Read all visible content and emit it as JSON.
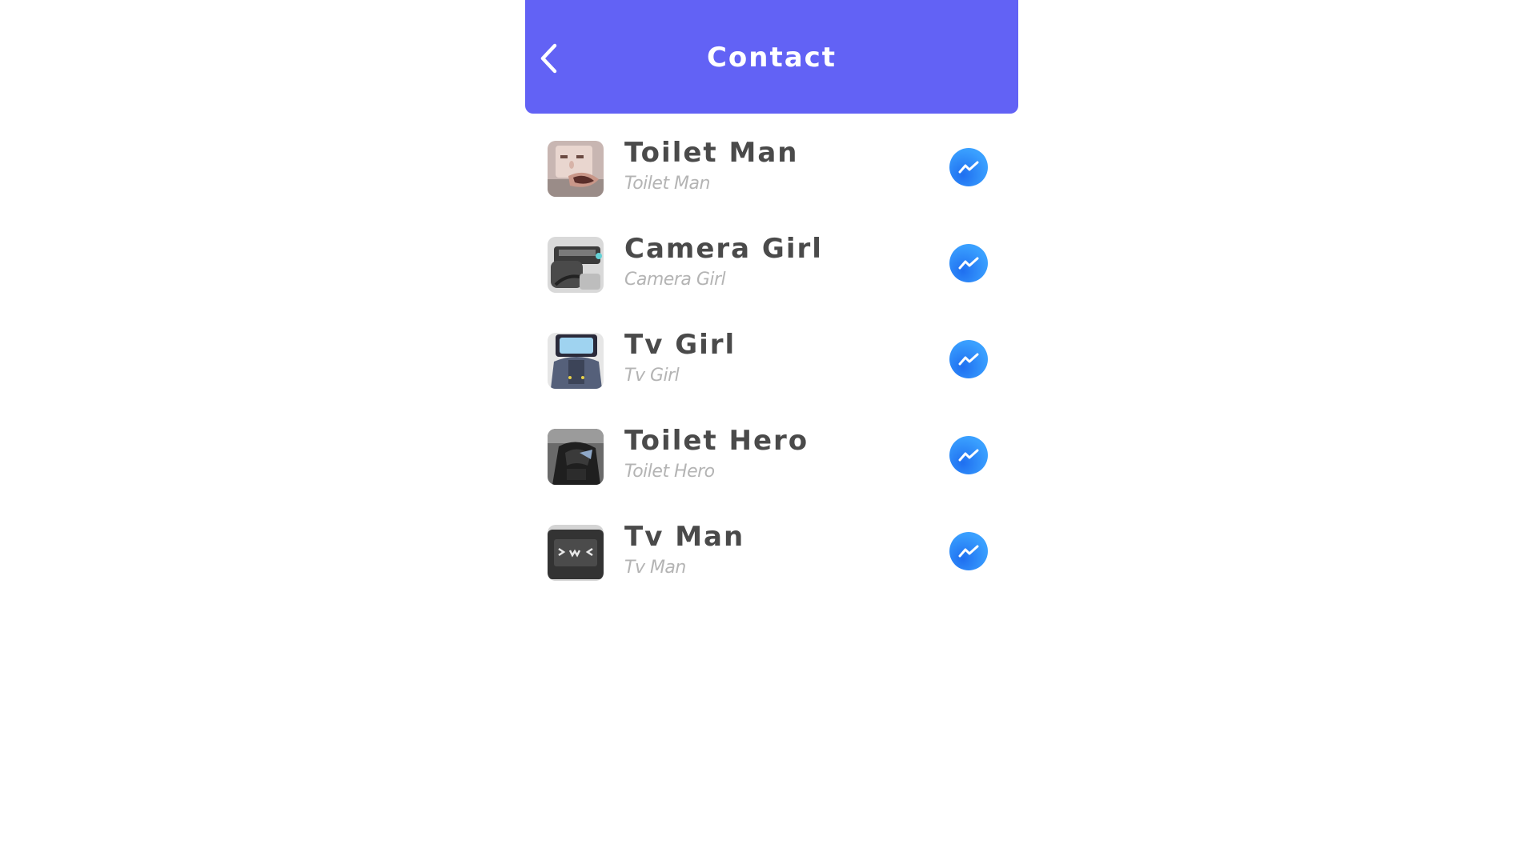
{
  "header": {
    "title": "Contact",
    "back_icon": "chevron-left-icon"
  },
  "contacts": [
    {
      "name": "Toilet Man",
      "subtitle": "Toilet Man",
      "action_icon": "messenger-icon"
    },
    {
      "name": "Camera Girl",
      "subtitle": "Camera Girl",
      "action_icon": "messenger-icon"
    },
    {
      "name": "Tv Girl",
      "subtitle": "Tv Girl",
      "action_icon": "messenger-icon"
    },
    {
      "name": "Toilet Hero",
      "subtitle": "Toilet Hero",
      "action_icon": "messenger-icon"
    },
    {
      "name": "Tv Man",
      "subtitle": "Tv Man",
      "action_icon": "messenger-icon"
    }
  ],
  "colors": {
    "header_bg": "#6262f5",
    "name_text": "#4a4a4a",
    "subtitle_text": "#b4b4b4",
    "messenger_blue": "#2f8af5"
  }
}
